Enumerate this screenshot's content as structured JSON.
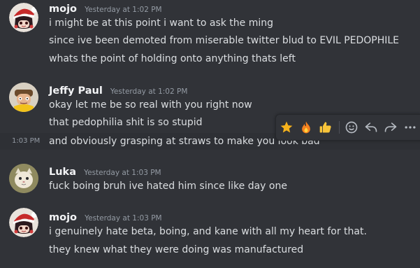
{
  "messages": [
    {
      "author": "mojo",
      "timestamp": "Yesterday at 1:02 PM",
      "lines": [
        "i might be at this point i want to ask the ming",
        "since ive been demoted from miserable twitter blud to EVIL PEDOPHILE",
        "whats the point of holding onto anything thats left"
      ]
    },
    {
      "author": "Jeffy Paul",
      "timestamp": "Yesterday at 1:02 PM",
      "lines": [
        "okay let me be so real with you right now",
        "that pedophilia shit is so stupid",
        "and obviously grasping at straws to make you look bad"
      ],
      "hover_timestamp": "1:03 PM"
    },
    {
      "author": "Luka",
      "timestamp": "Yesterday at 1:03 PM",
      "lines": [
        "fuck boing bruh ive hated him since like day one"
      ]
    },
    {
      "author": "mojo",
      "timestamp": "Yesterday at 1:03 PM",
      "lines": [
        "i genuinely hate beta, boing, and kane with all my heart for that.",
        "they knew what they were doing was manufactured"
      ]
    }
  ],
  "toolbar": {
    "reactions": [
      "star",
      "fire",
      "thumbs-up"
    ],
    "actions": [
      "add-reaction-icon",
      "reply-icon",
      "forward-icon",
      "more-icon"
    ]
  },
  "colors": {
    "background": "#313338",
    "hover_background": "#2e3035",
    "author": "#f2f3f5",
    "text": "#dbdee1",
    "timestamp": "#949ba4"
  }
}
